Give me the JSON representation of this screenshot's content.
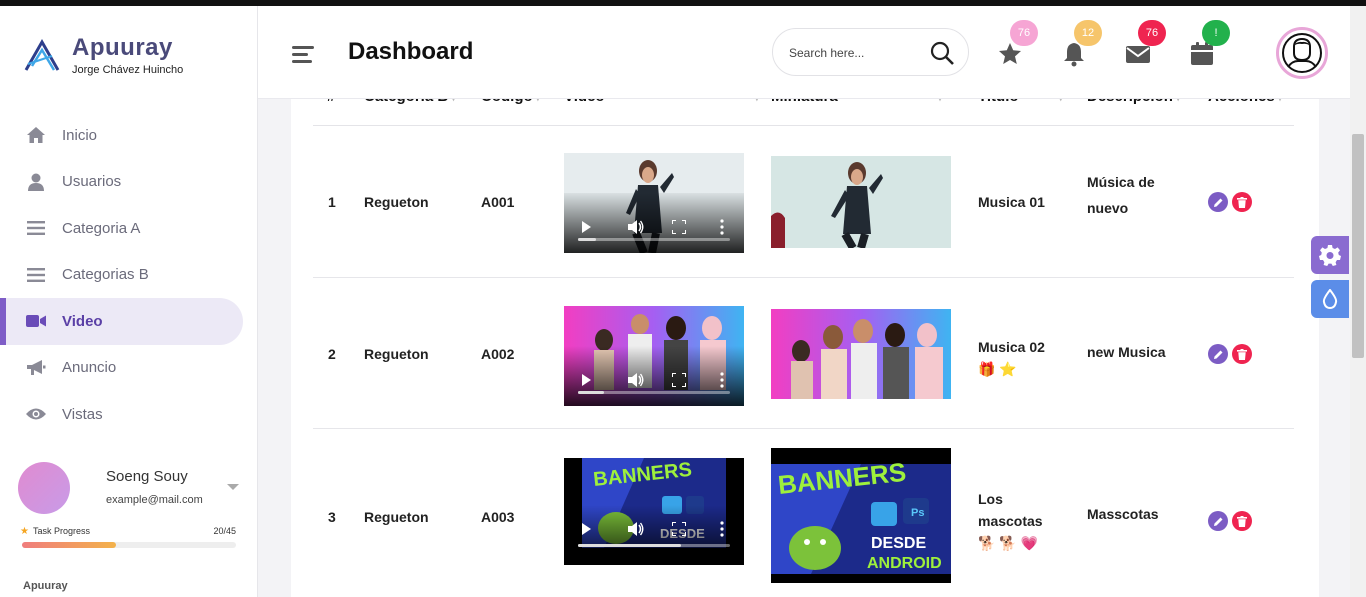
{
  "brand": {
    "name": "Apuuray",
    "subtitle": "Jorge Chávez Huincho"
  },
  "sidebar": {
    "items": [
      {
        "label": "Inicio",
        "icon": "home-icon"
      },
      {
        "label": "Usuarios",
        "icon": "user-icon"
      },
      {
        "label": "Categoria A",
        "icon": "list-icon"
      },
      {
        "label": "Categorias B",
        "icon": "list-icon"
      },
      {
        "label": "Video",
        "icon": "video-icon",
        "active": true
      },
      {
        "label": "Anuncio",
        "icon": "megaphone-icon"
      },
      {
        "label": "Vistas",
        "icon": "eye-icon"
      }
    ],
    "profile": {
      "name": "Soeng Souy",
      "email": "example@mail.com",
      "task_label": "Task Progress",
      "task_count": "20/45",
      "task_progress": 0.44
    },
    "footer_label": "Apuuray"
  },
  "header": {
    "title": "Dashboard",
    "search_placeholder": "Search here...",
    "badges": {
      "favorites": {
        "count": "76",
        "color": "#f6a5d4",
        "icon": "star-icon"
      },
      "notifications": {
        "count": "12",
        "color": "#f6c56b",
        "icon": "bell-icon"
      },
      "messages": {
        "count": "76",
        "color": "#ef2450",
        "icon": "mail-icon"
      },
      "calendar": {
        "count": "!",
        "color": "#22b14c",
        "icon": "calendar-icon"
      }
    },
    "avatar_icon": "user-avatar-icon"
  },
  "table": {
    "columns": [
      "#",
      "Categoria B",
      "Codigo",
      "Video",
      "Miniatura",
      "Titulo",
      "Descripcion",
      "Acciones"
    ],
    "rows": [
      {
        "index": "1",
        "category": "Regueton",
        "code": "A001",
        "title": "Musica 01",
        "title_emoji": "",
        "description": "Música de nuevo",
        "video_progress": 0.12
      },
      {
        "index": "2",
        "category": "Regueton",
        "code": "A002",
        "title": "Musica 02",
        "title_emoji": "🎁 ⭐",
        "description": "new Musica",
        "video_progress": 0.17
      },
      {
        "index": "3",
        "category": "Regueton",
        "code": "A003",
        "title": "Los mascotas",
        "title_emoji": "🐕 🐕 💗",
        "description": "Masscotas",
        "video_progress": 0.68
      }
    ]
  },
  "colors": {
    "accent": "#7e5dc7",
    "danger": "#ef2450",
    "info": "#5b8de8"
  }
}
